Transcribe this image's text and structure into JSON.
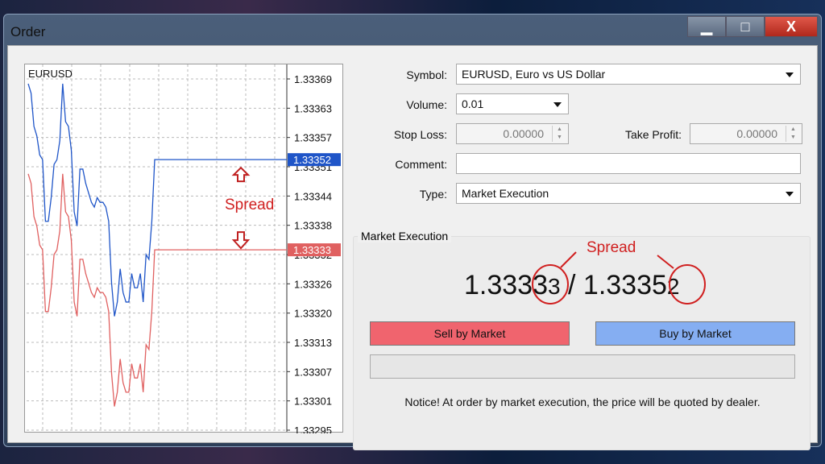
{
  "window": {
    "title": "Order",
    "controls": {
      "minimize": "minimize-icon",
      "maximize": "maximize-icon",
      "close": "X"
    }
  },
  "chart_data": {
    "type": "line",
    "title": "EURUSD",
    "ylim": [
      1.33295,
      1.33369
    ],
    "yticks": [
      "1.33369",
      "1.33363",
      "1.33357",
      "1.33351",
      "1.33344",
      "1.33338",
      "1.33332",
      "1.33326",
      "1.33320",
      "1.33313",
      "1.33307",
      "1.33301",
      "1.33295"
    ],
    "grid": true,
    "series": [
      {
        "color": "#1f55c8",
        "values": [
          1.33368,
          1.33366,
          1.33359,
          1.33357,
          1.33353,
          1.33352,
          1.33339,
          1.33339,
          1.33344,
          1.33351,
          1.33352,
          1.33356,
          1.33368,
          1.3336,
          1.33359,
          1.33354,
          1.33341,
          1.33338,
          1.3335,
          1.3335,
          1.33347,
          1.33345,
          1.33343,
          1.33342,
          1.33344,
          1.33343,
          1.33343,
          1.33342,
          1.33339,
          1.33326,
          1.33319,
          1.33322,
          1.33329,
          1.33324,
          1.33322,
          1.33322,
          1.33328,
          1.33325,
          1.33325,
          1.33328,
          1.33322,
          1.33332,
          1.33331,
          1.33339,
          1.33352
        ]
      },
      {
        "color": "#e06060",
        "values": [
          1.33349,
          1.33347,
          1.3334,
          1.33338,
          1.33334,
          1.33333,
          1.3332,
          1.3332,
          1.33325,
          1.33332,
          1.33333,
          1.33337,
          1.33349,
          1.33341,
          1.3334,
          1.33335,
          1.33322,
          1.33319,
          1.33331,
          1.33331,
          1.33328,
          1.33326,
          1.33324,
          1.33323,
          1.33325,
          1.33324,
          1.33324,
          1.33323,
          1.3332,
          1.33307,
          1.333,
          1.33303,
          1.3331,
          1.33305,
          1.33303,
          1.33303,
          1.33309,
          1.33306,
          1.33306,
          1.33309,
          1.33303,
          1.33313,
          1.33312,
          1.3332,
          1.33333
        ]
      }
    ],
    "ask_label": "1.33352",
    "bid_label": "1.33333",
    "annotation": "Spread"
  },
  "form": {
    "symbol_label": "Symbol:",
    "symbol_value": "EURUSD, Euro vs US Dollar",
    "volume_label": "Volume:",
    "volume_value": "0.01",
    "stop_loss_label": "Stop Loss:",
    "stop_loss_value": "0.00000",
    "take_profit_label": "Take Profit:",
    "take_profit_value": "0.00000",
    "comment_label": "Comment:",
    "comment_value": "",
    "type_label": "Type:",
    "type_value": "Market Execution"
  },
  "market": {
    "group_label": "Market Execution",
    "bid_main": "1.3333",
    "bid_last": "3",
    "separator": " / ",
    "ask_main": "1.3335",
    "ask_last": "2",
    "spread_annotation": "Spread",
    "sell_label": "Sell by Market",
    "buy_label": "Buy by Market",
    "sell_color": "#f0646e",
    "buy_color": "#85aef2",
    "notice": "Notice! At order by market execution, the price will be quoted by dealer."
  }
}
